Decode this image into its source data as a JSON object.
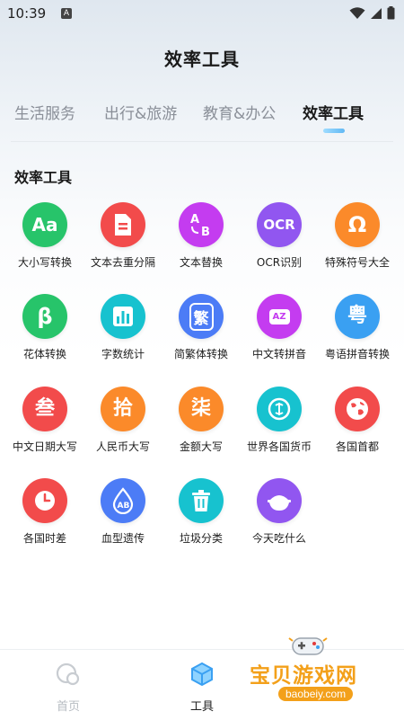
{
  "status_bar": {
    "time": "10:39",
    "notification_badge": "A"
  },
  "page_title": "效率工具",
  "tabs": [
    {
      "label": "生活服务",
      "active": false
    },
    {
      "label": "出行&旅游",
      "active": false
    },
    {
      "label": "教育&办公",
      "active": false
    },
    {
      "label": "效率工具",
      "active": true
    }
  ],
  "section_title": "效率工具",
  "tools": [
    {
      "label": "大小写转换",
      "icon": "Aa",
      "color": "#27c46a"
    },
    {
      "label": "文本去重分隔",
      "icon": "document-icon",
      "color": "#f24b4b"
    },
    {
      "label": "文本替换",
      "icon": "AB",
      "color": "#c43cf0"
    },
    {
      "label": "OCR识别",
      "icon": "OCR",
      "color": "#9156f0"
    },
    {
      "label": "特殊符号大全",
      "icon": "Ω",
      "color": "#fb8a2a"
    },
    {
      "label": "花体转换",
      "icon": "β",
      "color": "#27c46a"
    },
    {
      "label": "字数统计",
      "icon": "bar-chart-icon",
      "color": "#17c2cf"
    },
    {
      "label": "简繁体转换",
      "icon": "繁",
      "color": "#4c7cf6"
    },
    {
      "label": "中文转拼音",
      "icon": "AZ",
      "color": "#c43cf0"
    },
    {
      "label": "粤语拼音转换",
      "icon": "粤",
      "color": "#3aa0f2"
    },
    {
      "label": "中文日期大写",
      "icon": "叁",
      "color": "#f24b4b"
    },
    {
      "label": "人民币大写",
      "icon": "拾",
      "color": "#fb8a2a"
    },
    {
      "label": "金额大写",
      "icon": "柒",
      "color": "#fb8a2a"
    },
    {
      "label": "世界各国货币",
      "icon": "money-icon",
      "color": "#17c2cf"
    },
    {
      "label": "各国首都",
      "icon": "globe-icon",
      "color": "#f24b4b"
    },
    {
      "label": "各国时差",
      "icon": "clock-icon",
      "color": "#f24b4b"
    },
    {
      "label": "血型遗传",
      "icon": "AB",
      "color": "#4c7cf6"
    },
    {
      "label": "垃圾分类",
      "icon": "trash-icon",
      "color": "#17c2cf"
    },
    {
      "label": "今天吃什么",
      "icon": "bowl-icon",
      "color": "#9156f0"
    }
  ],
  "bottom_nav": [
    {
      "label": "首页",
      "active": false
    },
    {
      "label": "工具",
      "active": true
    }
  ],
  "watermark": {
    "text": "宝贝游戏网",
    "url": "baobeiy.com"
  }
}
